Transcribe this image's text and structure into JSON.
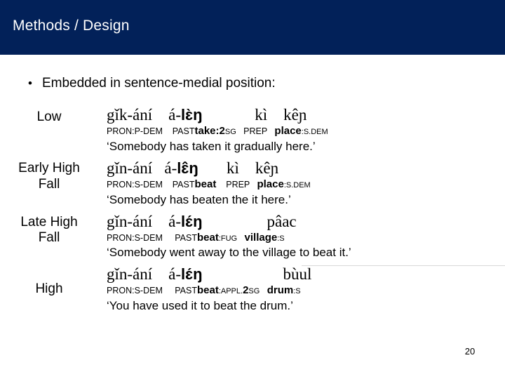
{
  "slide": {
    "title": "Methods / Design",
    "title_bar_color": "#022159",
    "background_color": "#ffffff",
    "slide_number": "20",
    "bullet": {
      "marker": "•",
      "text": "Embedded in sentence-medial position:"
    }
  },
  "examples": [
    {
      "label": "Low",
      "vernacular": {
        "pre": "gǐk-ání    á-",
        "bold": "lɛ̀ŋ",
        "post": "             kì    kêɲ"
      },
      "gloss": {
        "p1": "PRON:P-DEM",
        "p2_sc": "    PAST",
        "p2_bold": "take:2",
        "p2_small": "SG",
        "p3_sc": "   PREP   ",
        "p3_bold": "place",
        "p3_small": ":S.DEM"
      },
      "translation": "‘Somebody has taken it gradually here.’"
    },
    {
      "label": "Early High\nFall",
      "vernacular": {
        "pre": "gǐn-ání   á-",
        "bold": "lɛ̂ŋ",
        "post": "       kì    kêɲ"
      },
      "gloss": {
        "p1": "PRON:S-DEM",
        "p2_sc": "    PAST",
        "p2_bold": "beat",
        "p2_small": "",
        "p3_sc": "    PREP   ",
        "p3_bold": "place",
        "p3_small": ":S.DEM"
      },
      "translation": "‘Somebody has beaten the it here.’"
    },
    {
      "label": "Late High\nFall",
      "vernacular": {
        "pre": "gǐn-ání    á-",
        "bold": "lɛ́ŋ",
        "post": "                pâac"
      },
      "gloss": {
        "p1": "PRON:S-DEM",
        "p2_sc": "     PAST",
        "p2_bold": "beat",
        "p2_small": ":FUG",
        "p3_sc": "   ",
        "p3_bold": "village",
        "p3_small": ":S"
      },
      "translation": "‘Somebody went away to the village to beat it.’"
    },
    {
      "label": "High",
      "vernacular": {
        "pre": "gǐn-ání    á-",
        "bold": "lɛ́ŋ",
        "post": "                    bùul"
      },
      "gloss": {
        "p1": "PRON:S-DEM",
        "p2_sc": "     PAST",
        "p2_bold": "beat",
        "p2_small": ":APPL.",
        "p2_bold2": "2",
        "p2_small2": "SG",
        "p3_sc": "   ",
        "p3_bold": "drum",
        "p3_small": ":S"
      },
      "translation": "‘You have used it to beat the drum.’"
    }
  ]
}
